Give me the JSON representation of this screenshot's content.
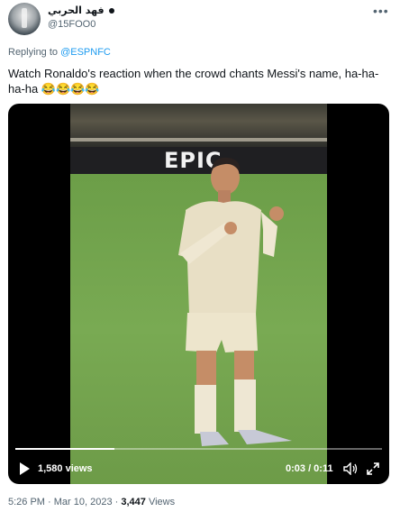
{
  "author": {
    "display_name": "فهد الحربي",
    "handle": "@15FOO0"
  },
  "reply": {
    "prefix": "Replying to ",
    "target": "@ESPNFC"
  },
  "tweet": {
    "text": "Watch Ronaldo's reaction when the crowd chants Messi's name, ha-ha-ha-ha 😂😂😂😂"
  },
  "video": {
    "board_text": "EPIC",
    "views_label": "1,580 views",
    "time_label": "0:03 / 0:11",
    "progress": 0.27
  },
  "meta": {
    "time": "5:26 PM",
    "separator": " · ",
    "date": "Mar 10, 2023",
    "views_count": "3,447",
    "views_word": " Views"
  },
  "icons": [
    "avatar",
    "verified-dot",
    "more-icon",
    "play-icon",
    "volume-icon",
    "fullscreen-icon"
  ],
  "colors": {
    "link": "#1d9bf0",
    "secondary": "#536471",
    "primary_text": "#0f1419"
  }
}
